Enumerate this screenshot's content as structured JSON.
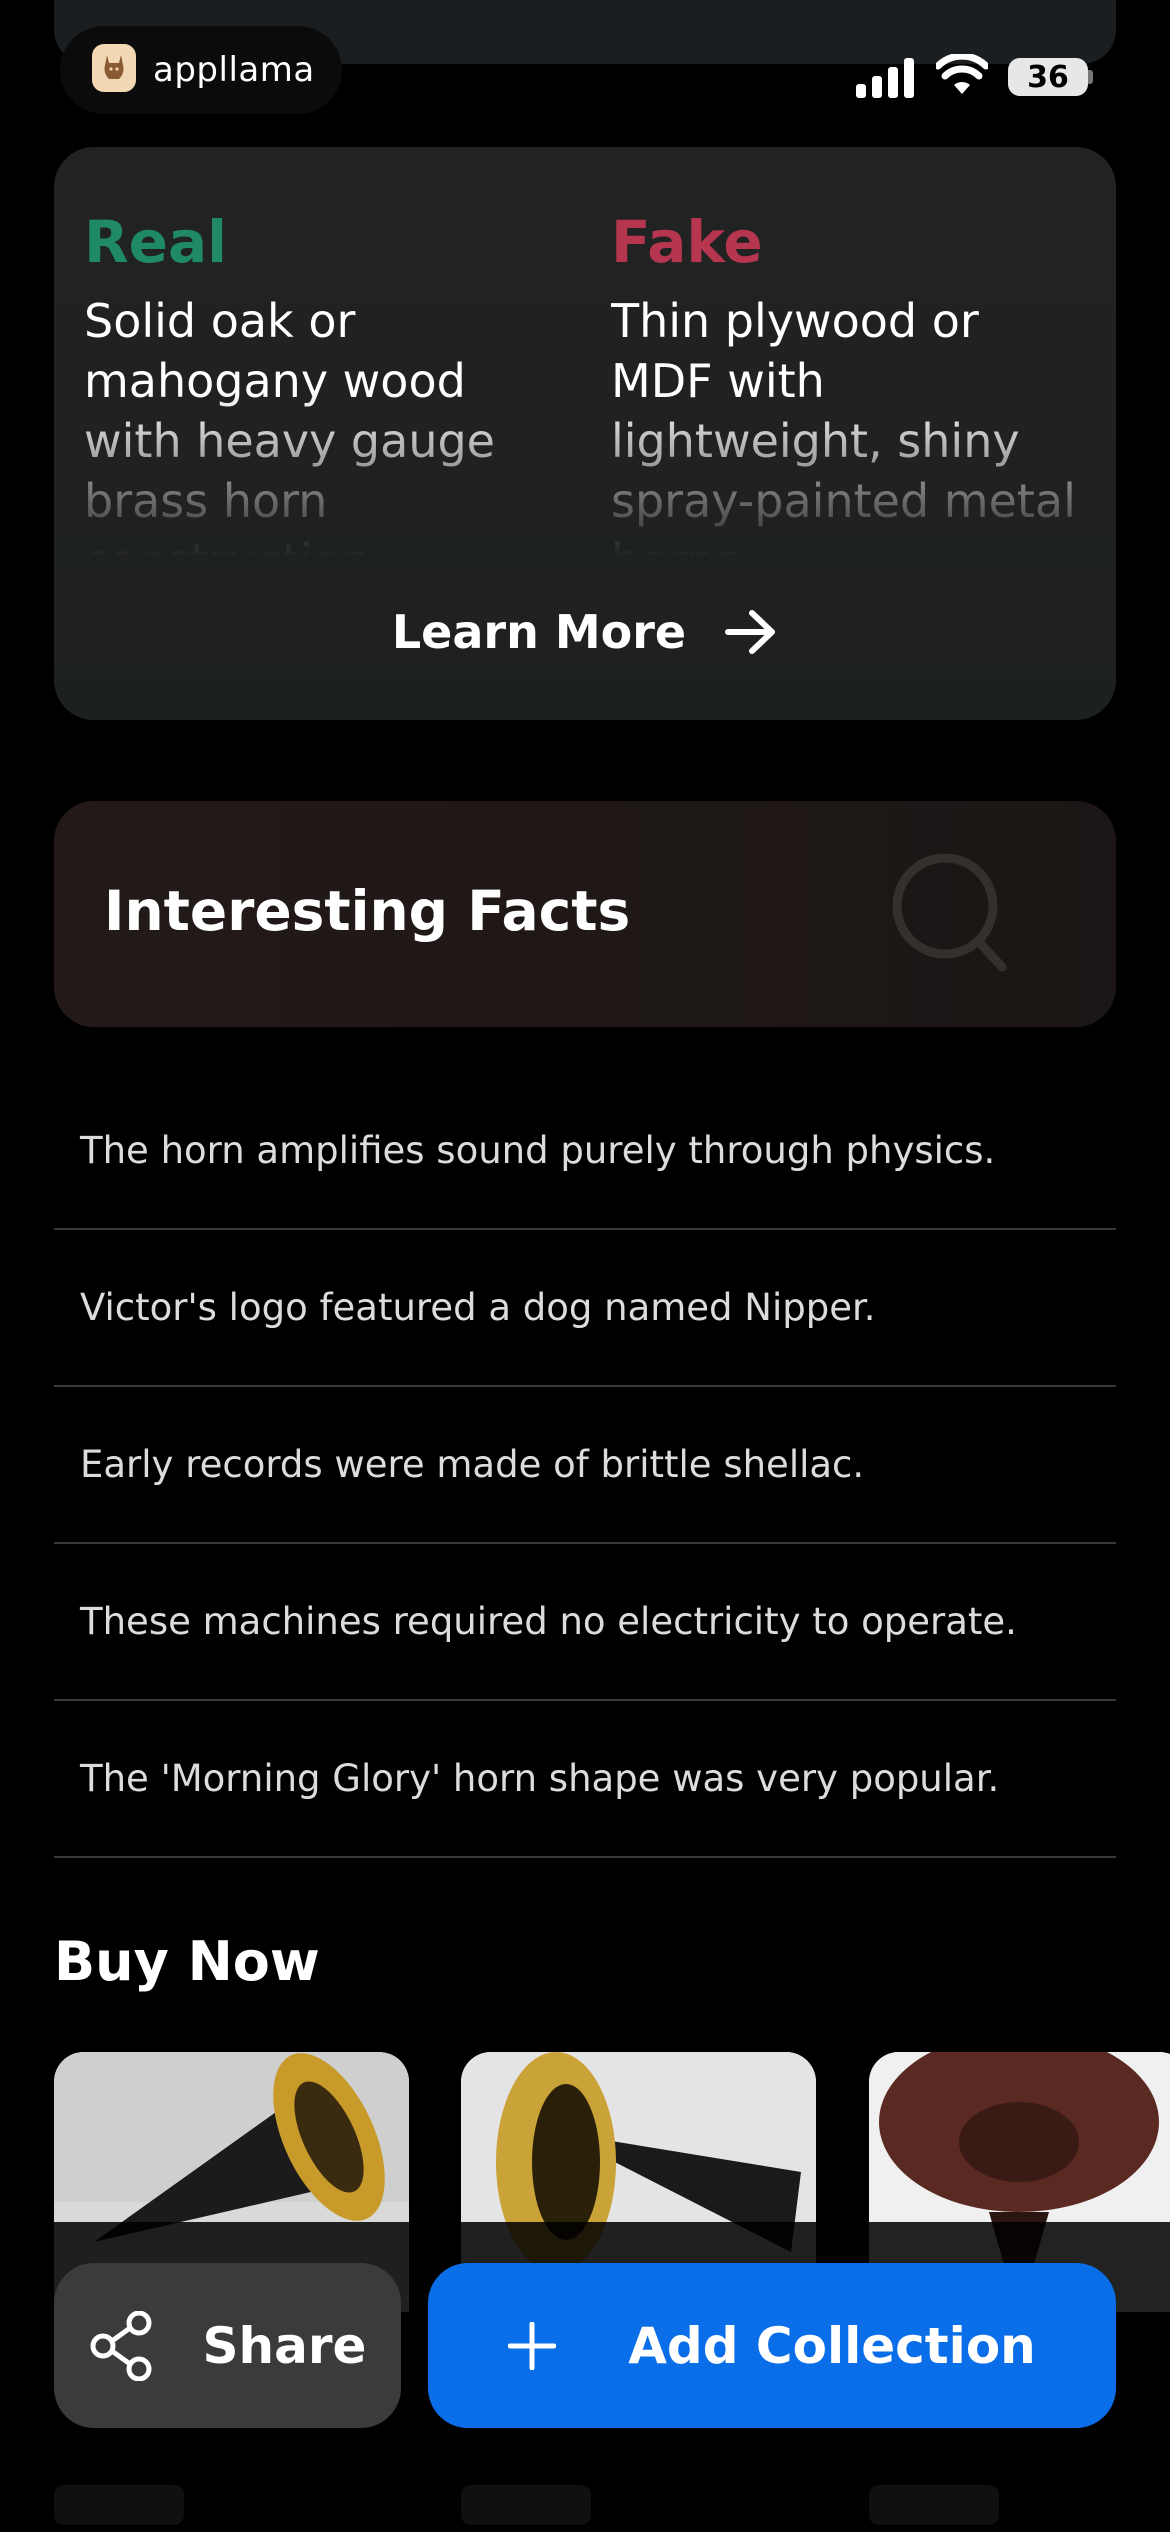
{
  "status_bar": {
    "app_name": "appllama",
    "battery": "36"
  },
  "real_fake": {
    "real_title": "Real",
    "real_text": "Solid oak or mahogany wood with heavy gauge brass horn construction.",
    "fake_title": "Fake",
    "fake_text": "Thin plywood or MDF with lightweight, shiny spray-painted metal horns.",
    "learn_more": "Learn More",
    "real_color": "#1f8a64",
    "fake_color": "#b7364f"
  },
  "facts": {
    "title": "Interesting Facts",
    "items": [
      "The horn amplifies sound purely through physics.",
      "Victor's logo featured a dog named Nipper.",
      "Early records were made of brittle shellac.",
      "These machines required no electricity to operate.",
      "The 'Morning Glory' horn shape was very popular."
    ]
  },
  "buy_now": {
    "title": "Buy Now"
  },
  "actions": {
    "share": "Share",
    "add_collection": "Add Collection",
    "accent": "#0a6ee8"
  }
}
